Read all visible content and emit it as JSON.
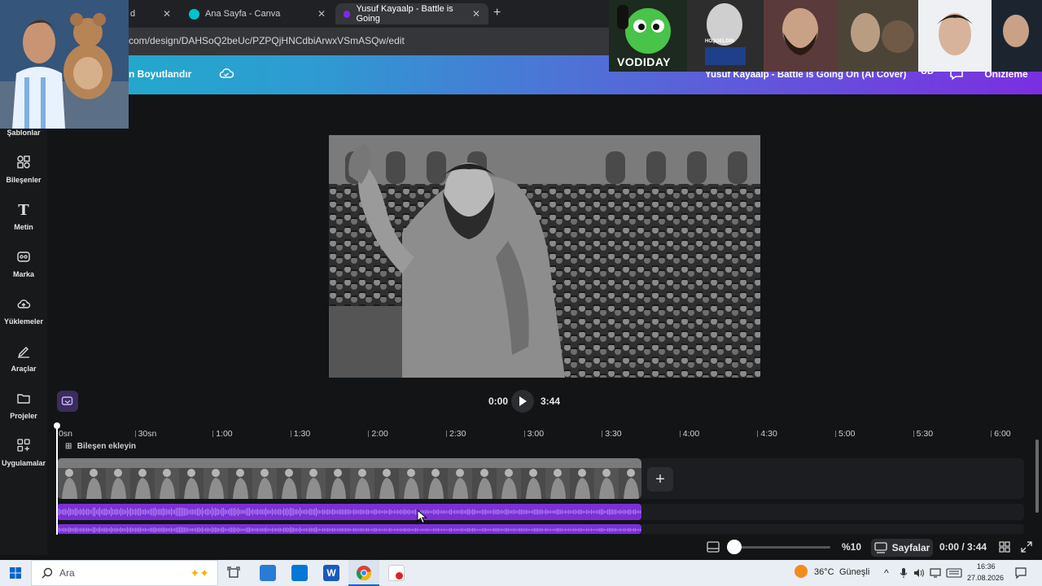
{
  "browser": {
    "tabs": [
      {
        "label": "d",
        "active": false
      },
      {
        "label": "Ana Sayfa - Canva",
        "active": false
      },
      {
        "label": "Yusuf Kayaalp - Battle is Going",
        "active": true
      }
    ],
    "close_glyph": "✕",
    "new_tab_glyph": "+",
    "url": "com/design/DAHSoQ2beUc/PZPQjHNCdbiArwxVSmASQw/edit"
  },
  "header": {
    "resize_label": "n Boyutlandır",
    "design_title": "Yusuf Kayaalp - Battle is Going On (AI Cover)",
    "avatar_initials": "UD",
    "preview_label": "Önizleme"
  },
  "sidebar": {
    "items": [
      {
        "label": "Şablonlar",
        "icon": "template-icon"
      },
      {
        "label": "Bileşenler",
        "icon": "elements-icon"
      },
      {
        "label": "Metin",
        "icon": "text-icon"
      },
      {
        "label": "Marka",
        "icon": "brand-icon"
      },
      {
        "label": "Yüklemeler",
        "icon": "upload-icon"
      },
      {
        "label": "Araçlar",
        "icon": "draw-icon"
      },
      {
        "label": "Projeler",
        "icon": "folder-icon"
      },
      {
        "label": "Uygulamalar",
        "icon": "apps-icon"
      }
    ]
  },
  "player": {
    "current_time": "0:00",
    "duration": "3:44"
  },
  "timeline": {
    "ruler": [
      "0sn",
      "30sn",
      "1:00",
      "1:30",
      "2:00",
      "2:30",
      "3:00",
      "3:30",
      "4:00",
      "4:30",
      "5:00",
      "5:30",
      "6:00"
    ],
    "add_component_label": "Bileşen ekleyin",
    "add_clip_glyph": "+"
  },
  "bottom_bar": {
    "zoom": "%10",
    "pages_label": "Sayfalar",
    "time_display": "0:00 / 3:44"
  },
  "overlay": {
    "streamer_label": "VODIDAY",
    "sign_text": "HOŞGELDİN"
  },
  "taskbar": {
    "search_placeholder": "Ara",
    "weather": "36°C",
    "weather_desc": "Güneşli",
    "time": "16:36",
    "date": "27.08.2026"
  },
  "colors": {
    "accent_purple": "#7b2fd6",
    "header_gradient_start": "#1cb0c9",
    "header_gradient_end": "#7b2fe0"
  }
}
